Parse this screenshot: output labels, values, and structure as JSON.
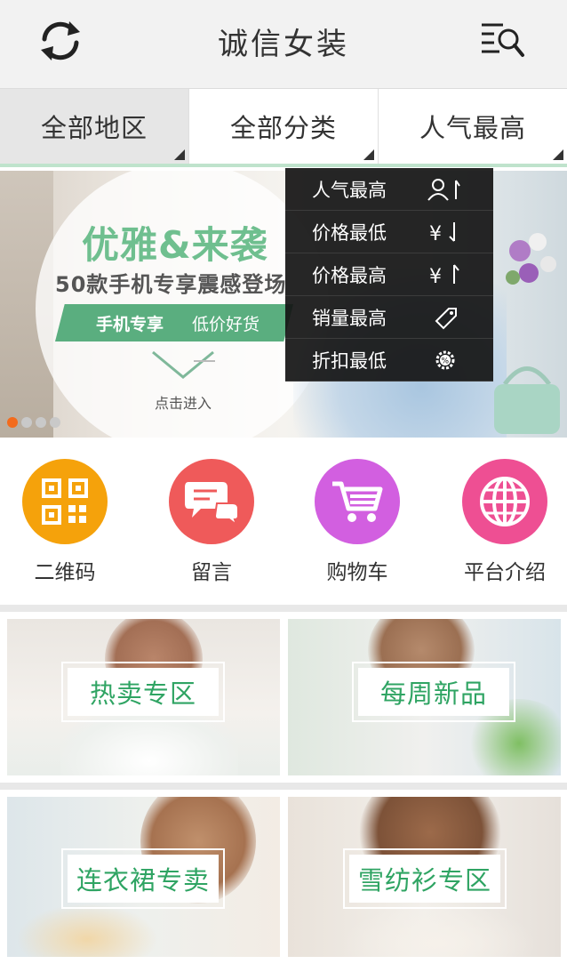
{
  "header": {
    "title": "诚信女装",
    "refresh_icon": "refresh-icon",
    "search_icon": "list-search-icon"
  },
  "filter_tabs": [
    {
      "label": "全部地区",
      "active": true
    },
    {
      "label": "全部分类",
      "active": false
    },
    {
      "label": "人气最高",
      "active": false
    }
  ],
  "sort_menu": [
    {
      "label": "人气最高",
      "icon": "person-up-icon"
    },
    {
      "label": "价格最低",
      "icon": "yen-down-icon"
    },
    {
      "label": "价格最高",
      "icon": "yen-up-icon"
    },
    {
      "label": "销量最高",
      "icon": "tag-icon"
    },
    {
      "label": "折扣最低",
      "icon": "discount-gear-icon"
    }
  ],
  "banner": {
    "headline": "优雅&来袭",
    "subline": "50款手机专享震感登场",
    "ribbon_main": "手机专享",
    "ribbon_sub": "低价好货",
    "enter_text": "点击进入",
    "active_dot": 1,
    "dot_count": 4
  },
  "quick_links": [
    {
      "label": "二维码",
      "icon": "qr-code-icon",
      "color": "#f5a20b"
    },
    {
      "label": "留言",
      "icon": "chat-icon",
      "color": "#ef5a5a"
    },
    {
      "label": "购物车",
      "icon": "cart-icon",
      "color": "#d25fe0"
    },
    {
      "label": "平台介绍",
      "icon": "globe-icon",
      "color": "#ee4f93"
    }
  ],
  "categories": [
    {
      "label": "热卖专区"
    },
    {
      "label": "每周新品"
    },
    {
      "label": "连衣裙专卖"
    },
    {
      "label": "雪纺衫专区"
    }
  ],
  "colors": {
    "accent_green": "#2fa463",
    "banner_green": "#6fbf8f",
    "active_dot": "#f36b1c"
  }
}
